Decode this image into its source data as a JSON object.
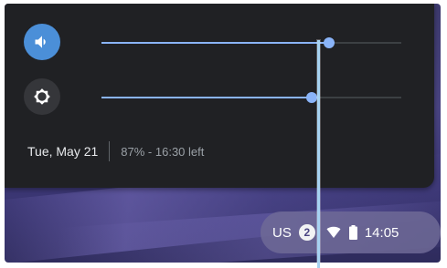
{
  "colors": {
    "accent": "#4b8fd8",
    "slider": "#8ab4f8",
    "panel_background": "#202124",
    "shelf_tray": "#6e6a96"
  },
  "quick_settings": {
    "volume": {
      "icon": "volume-icon",
      "level": 0.76
    },
    "brightness": {
      "icon": "brightness-icon",
      "level": 0.7
    },
    "date": "Tue, May 21",
    "battery_status": "87% - 16:30 left"
  },
  "shelf": {
    "input_method": "US",
    "notification_count": "2",
    "wifi_icon": "wifi-icon",
    "battery_icon": "battery-icon",
    "time": "14:05"
  }
}
